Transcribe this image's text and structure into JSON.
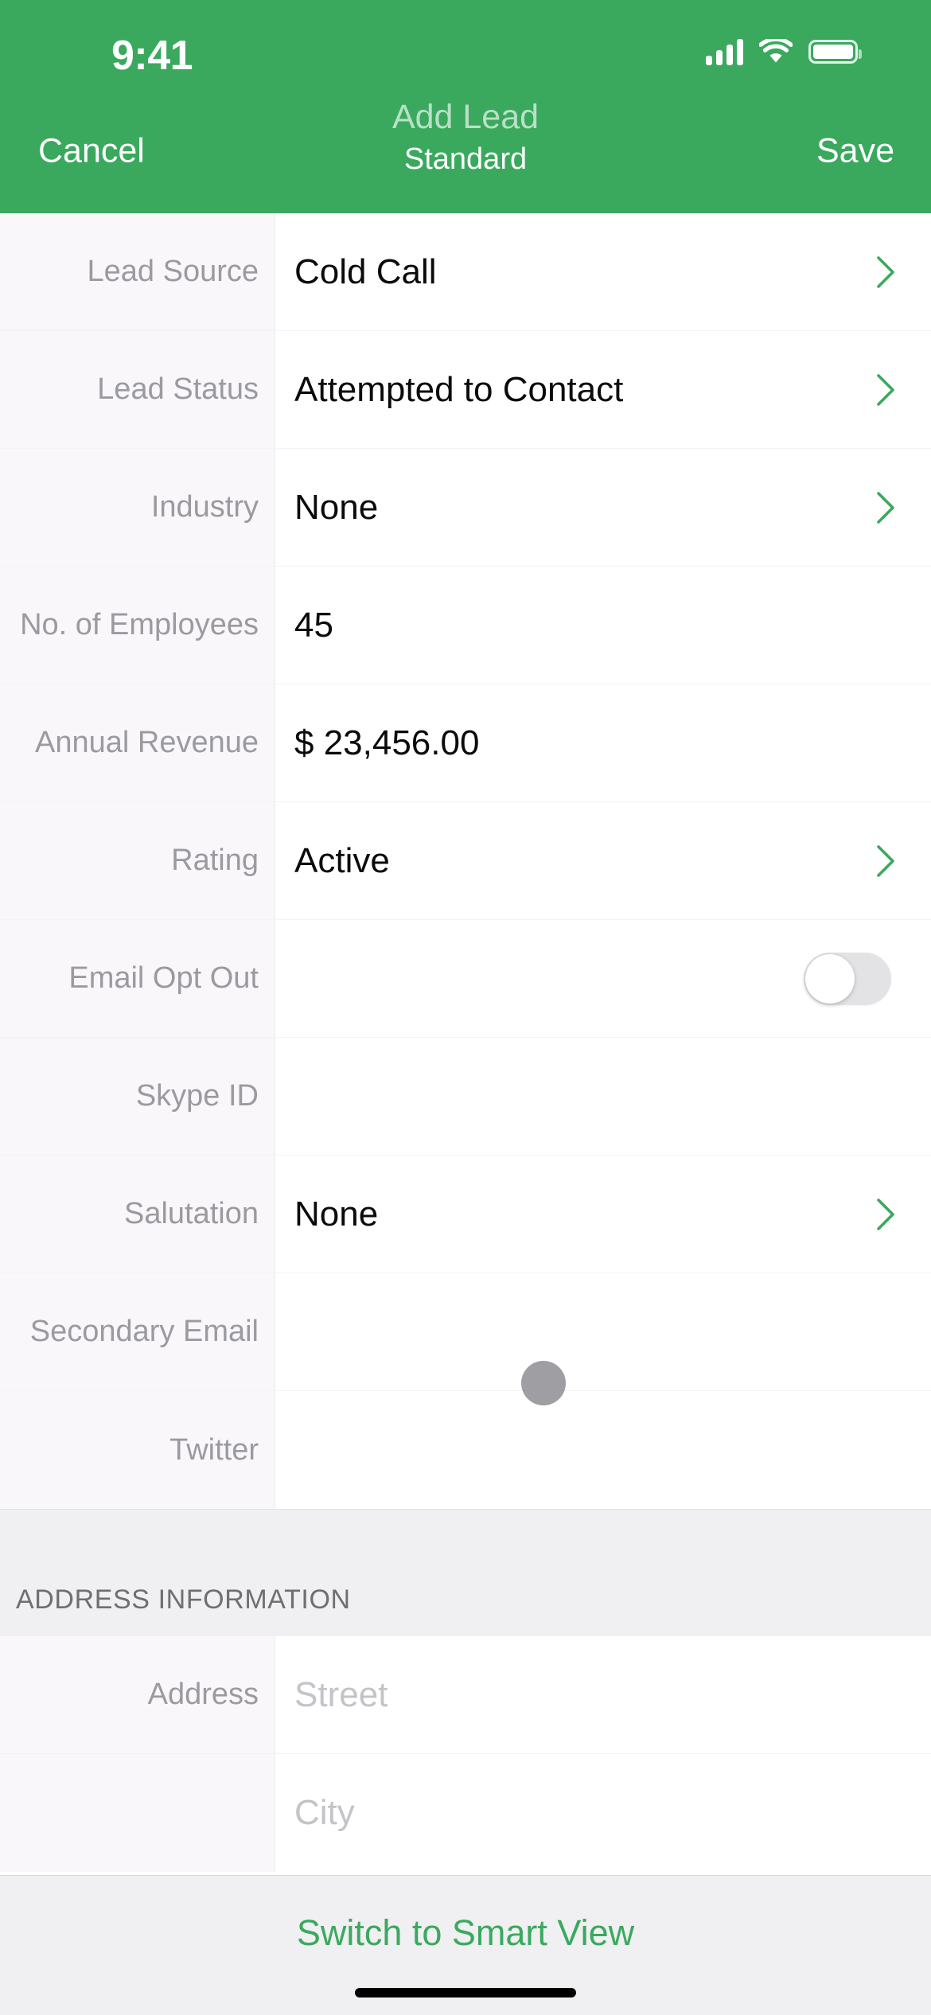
{
  "status_bar": {
    "time": "9:41",
    "icons": [
      "cellular-signal-icon",
      "wifi-icon",
      "battery-icon"
    ]
  },
  "nav_bar": {
    "cancel_label": "Cancel",
    "title": "Add Lead",
    "subtitle": "Standard",
    "save_label": "Save"
  },
  "colors": {
    "brand_green": "#3AA95E",
    "nav_title_muted": "#B9E0C6",
    "label_gray": "#9A9AA0",
    "value_black": "#0B0B0C",
    "placeholder_gray": "#C3C3C8",
    "label_gutter_bg": "#F9F7FA",
    "section_band_bg": "#F0EFF1",
    "toggle_off_track": "#E3E3E6",
    "tap_dot": "#9E9EA3"
  },
  "form": {
    "rows": [
      {
        "label": "Lead Source",
        "value": "Cold Call",
        "placeholder": "",
        "accessory": "chevron"
      },
      {
        "label": "Lead Status",
        "value": "Attempted to Contact",
        "placeholder": "",
        "accessory": "chevron"
      },
      {
        "label": "Industry",
        "value": "None",
        "placeholder": "",
        "accessory": "chevron"
      },
      {
        "label": "No. of Employees",
        "value": "45",
        "placeholder": "",
        "accessory": "none"
      },
      {
        "label": "Annual Revenue",
        "value": "$ 23,456.00",
        "placeholder": "",
        "accessory": "none"
      },
      {
        "label": "Rating",
        "value": "Active",
        "placeholder": "",
        "accessory": "chevron"
      },
      {
        "label": "Email Opt Out",
        "value": "",
        "placeholder": "",
        "accessory": "toggle",
        "toggle_on": false
      },
      {
        "label": "Skype ID",
        "value": "",
        "placeholder": "",
        "accessory": "none"
      },
      {
        "label": "Salutation",
        "value": "None",
        "placeholder": "",
        "accessory": "chevron"
      },
      {
        "label": "Secondary Email",
        "value": "",
        "placeholder": "",
        "accessory": "none"
      },
      {
        "label": "Twitter",
        "value": "",
        "placeholder": "",
        "accessory": "none"
      }
    ]
  },
  "address_section": {
    "header": "ADDRESS INFORMATION",
    "rows": [
      {
        "label": "Address",
        "value": "",
        "placeholder": "Street",
        "accessory": "none"
      },
      {
        "label": "",
        "value": "",
        "placeholder": "City",
        "accessory": "none"
      }
    ]
  },
  "bottom_bar": {
    "smart_view_label": "Switch to Smart View"
  }
}
